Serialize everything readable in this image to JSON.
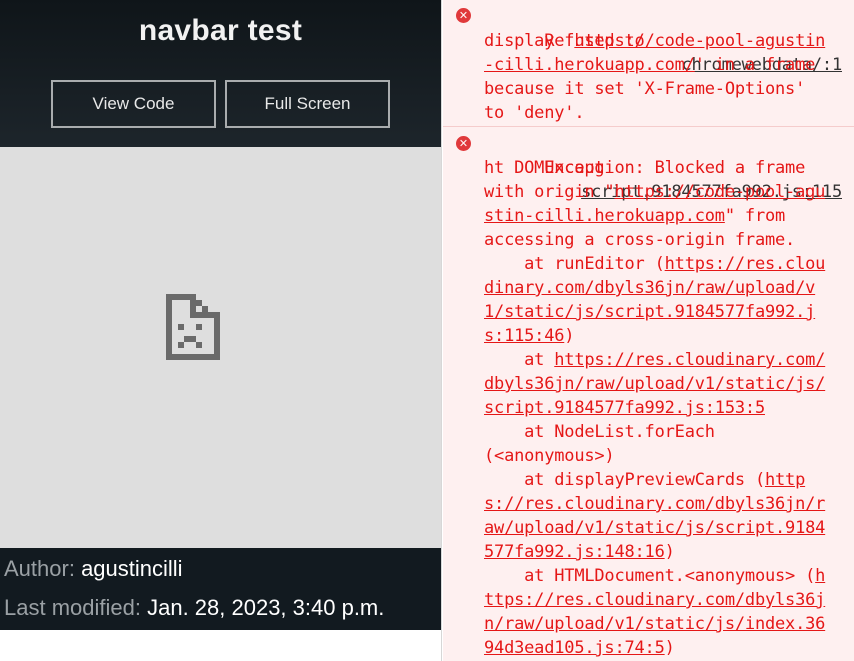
{
  "card": {
    "title": "navbar test",
    "view_code_label": "View Code",
    "full_screen_label": "Full Screen",
    "author_label": "Author:",
    "author_value": "agustincilli",
    "modified_label": "Last modified:",
    "modified_value": "Jan. 28, 2023, 3:40 p.m."
  },
  "console": {
    "error1": {
      "source": "chromewebdata/:1",
      "lines": [
        "Refused to",
        "display 'https://code-pool-agustin",
        "-cilli.herokuapp.com/' in a frame",
        "because it set 'X-Frame-Options'",
        "to 'deny'."
      ]
    },
    "error2": {
      "source": "script.9184577fa992.js:115",
      "lines": [
        "Uncaug",
        "ht DOMException: Blocked a frame",
        "with origin \"https://code-pool-agu",
        "stin-cilli.herokuapp.com\" from",
        "accessing a cross-origin frame.",
        "    at runEditor (https://res.clou",
        "dinary.com/dbyls36jn/raw/upload/v",
        "1/static/js/script.9184577fa992.j",
        "s:115:46)",
        "    at https://res.cloudinary.com/",
        "dbyls36jn/raw/upload/v1/static/js/",
        "script.9184577fa992.js:153:5",
        "    at NodeList.forEach",
        "(<anonymous>)",
        "    at displayPreviewCards (http",
        "s://res.cloudinary.com/dbyls36jn/r",
        "aw/upload/v1/static/js/script.9184",
        "577fa992.js:148:16)",
        "    at HTMLDocument.<anonymous> (h",
        "ttps://res.cloudinary.com/dbyls36j",
        "n/raw/upload/v1/static/js/index.36",
        "94d3ead105.js:74:5)"
      ]
    }
  },
  "icons": {
    "broken_page": "sad-page-icon",
    "error": "error-circle-icon"
  }
}
